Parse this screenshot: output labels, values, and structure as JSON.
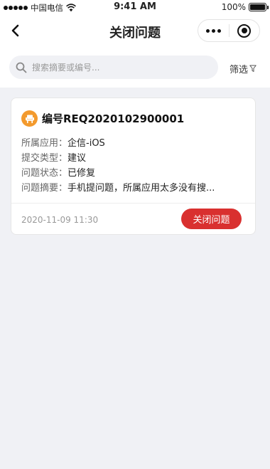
{
  "status_bar": {
    "carrier": "中国电信",
    "time": "9:41 AM",
    "battery_text": "100%",
    "battery_level": 1.0
  },
  "nav": {
    "title": "关闭问题"
  },
  "search": {
    "placeholder": "搜索摘要或编号...",
    "value": "",
    "filter_label": "筛选"
  },
  "issues": [
    {
      "number": "编号REQ2020102900001",
      "fields": [
        {
          "label": "所属应用：",
          "value": "企信-iOS"
        },
        {
          "label": "提交类型：",
          "value": "建议"
        },
        {
          "label": "问题状态：",
          "value": "已修复"
        },
        {
          "label": "问题摘要：",
          "value": "手机提问题，所属应用太多没有搜..."
        }
      ],
      "date": "2020-11-09  11:30",
      "action_label": "关闭问题"
    }
  ],
  "colors": {
    "accent_red": "#d9302f",
    "icon_orange": "#f39a2d",
    "page_bg": "#f0f1f5"
  },
  "icons": {
    "back": "chevron-left-icon",
    "more": "more-dots-icon",
    "close_miniprogram": "target-circle-icon",
    "search": "search-icon",
    "filter": "funnel-icon",
    "issue": "chair-icon"
  }
}
